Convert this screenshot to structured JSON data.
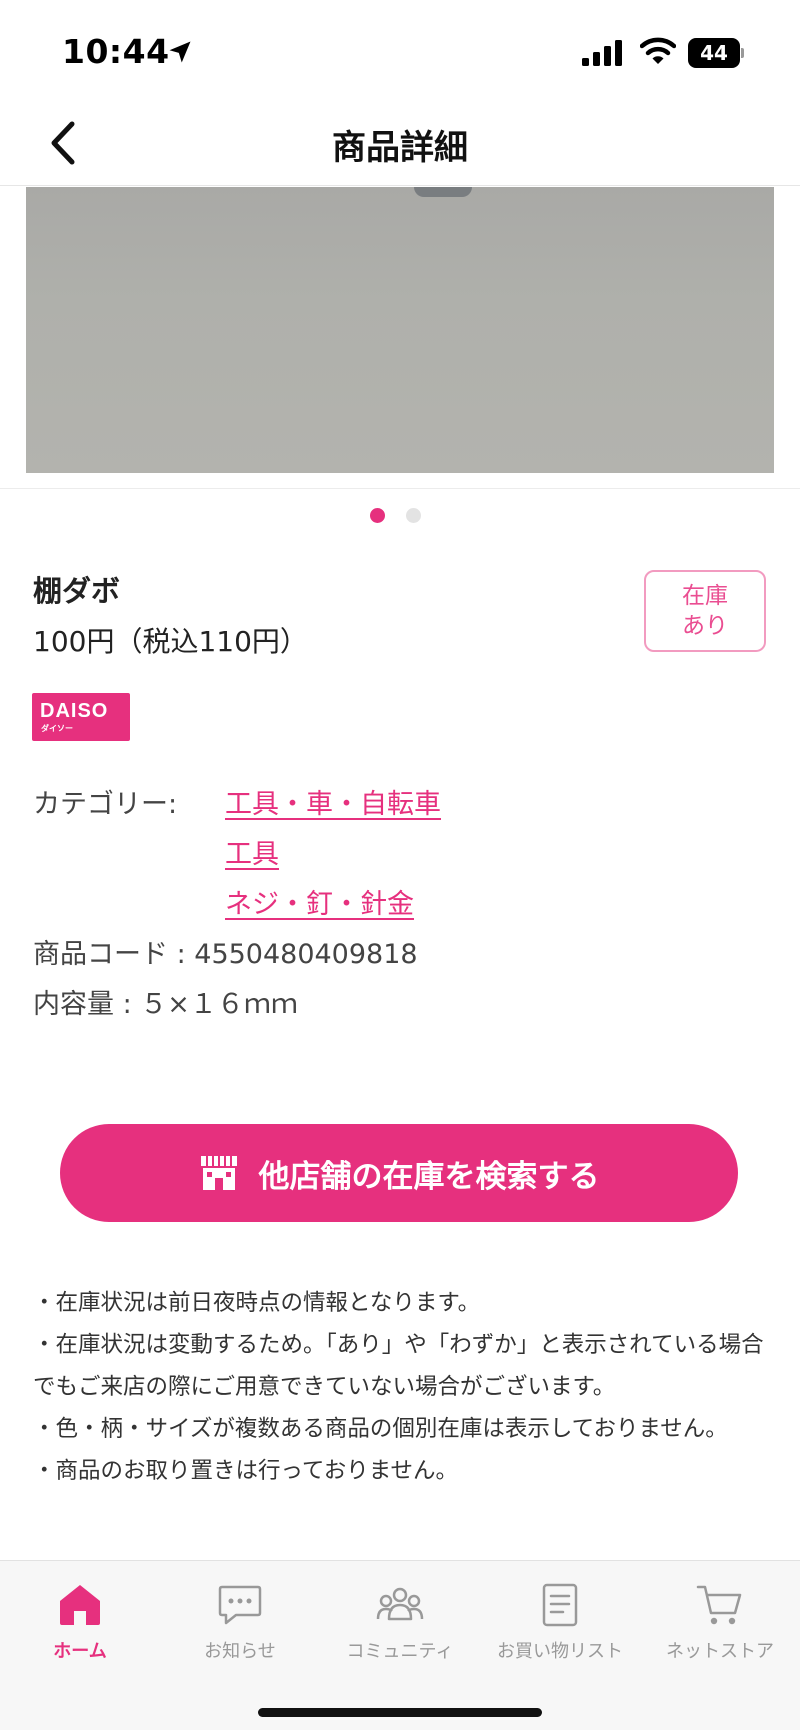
{
  "status_bar": {
    "time": "10:44",
    "battery": "44"
  },
  "nav": {
    "title": "商品詳細",
    "back_icon": "chevron-left-icon"
  },
  "gallery": {
    "total_images": 2,
    "active_index": 0
  },
  "product": {
    "name": "棚ダボ",
    "price": "100円（税込110円）",
    "stock_badge": [
      "在庫",
      "あり"
    ],
    "brand_logo": "DAISO",
    "brand_logo_sub": "ダイソー",
    "category_label": "カテゴリー:",
    "categories": [
      "工具・車・自転車",
      "工具",
      "ネジ・釘・針金"
    ],
    "code_row": "商品コード : 4550480409818",
    "volume_row": "内容量 : ５×１６ｍｍ"
  },
  "search_button": {
    "label": "他店舗の在庫を検索する",
    "icon": "store-icon"
  },
  "notes": [
    "・在庫状況は前日夜時点の情報となります。",
    "・在庫状況は変動するため。「あり」や「わずか」と表示されている場合でもご来店の際にご用意できていない場合がございます。",
    "・色・柄・サイズが複数ある商品の個別在庫は表示しておりません。",
    "・商品のお取り置きは行っておりません。"
  ],
  "tab_bar": {
    "items": [
      {
        "label": "ホーム",
        "icon": "home-icon",
        "active": true
      },
      {
        "label": "お知らせ",
        "icon": "chat-icon",
        "active": false
      },
      {
        "label": "コミュニティ",
        "icon": "community-icon",
        "active": false
      },
      {
        "label": "お買い物リスト",
        "icon": "list-icon",
        "active": false
      },
      {
        "label": "ネットストア",
        "icon": "cart-icon",
        "active": false
      }
    ]
  },
  "colors": {
    "accent": "#e6307e",
    "badge_border": "#f29bc0",
    "tab_inactive": "#999999"
  }
}
